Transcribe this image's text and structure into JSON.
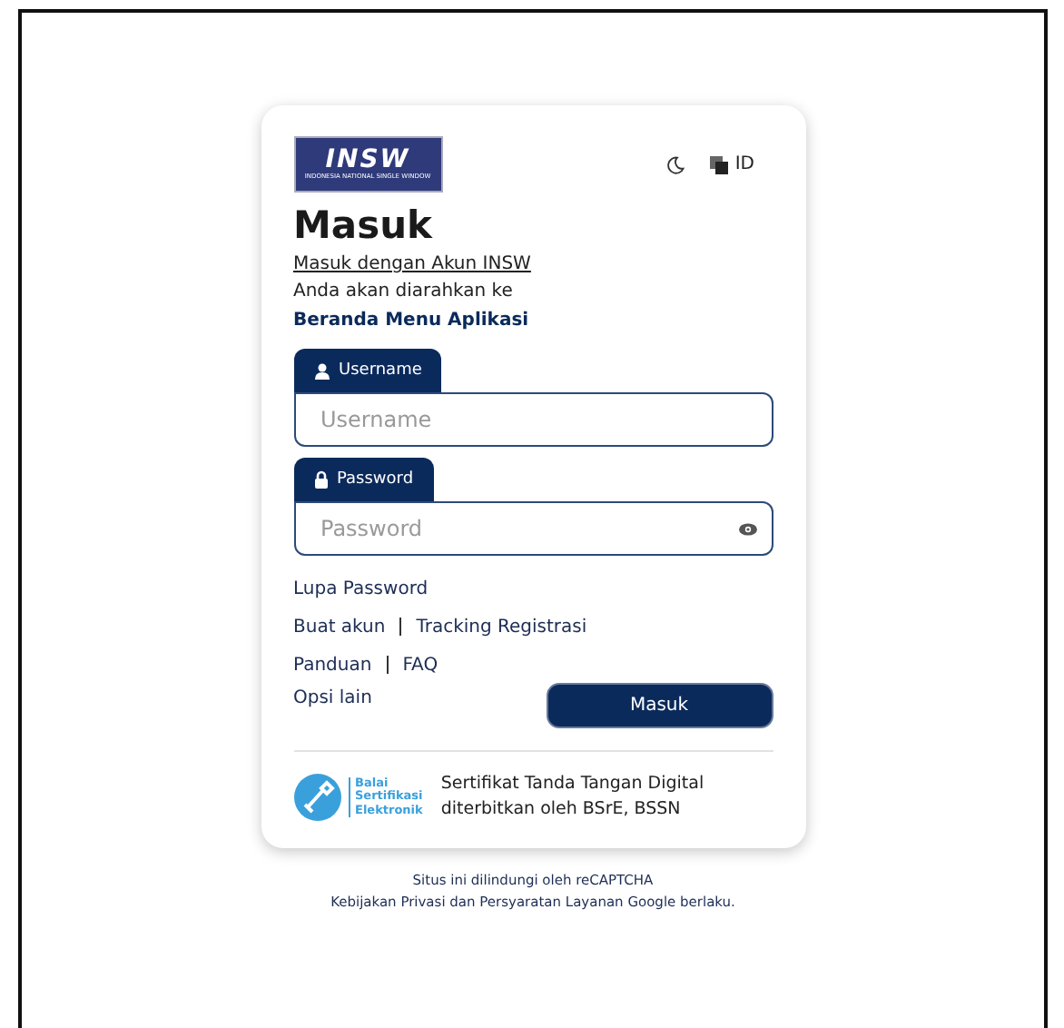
{
  "header": {
    "logo": {
      "mark": "INSW",
      "tagline": "INDONESIA NATIONAL SINGLE WINDOW"
    },
    "language": "ID"
  },
  "title": "Masuk",
  "subtitle_link": "Masuk dengan Akun INSW",
  "redirect_note": "Anda akan diarahkan ke",
  "redirect_target": "Beranda Menu Aplikasi",
  "fields": [
    {
      "kind": "user",
      "tab": "Username",
      "placeholder": "Username"
    },
    {
      "kind": "lock",
      "tab": "Password",
      "placeholder": "Password",
      "reveal": true
    }
  ],
  "link_rows": [
    [
      "Lupa Password"
    ],
    [
      "Buat akun",
      "Tracking Registrasi"
    ],
    [
      "Panduan",
      "FAQ"
    ]
  ],
  "other_options": "Opsi lain",
  "submit": "Masuk",
  "certificate": {
    "logo_lines": [
      "Balai",
      "Sertifikasi",
      "Elektronik"
    ],
    "text": "Sertifikat Tanda Tangan Digital diterbitkan oleh BSrE, BSSN"
  },
  "footer": [
    "Situs ini dilindungi oleh reCAPTCHA",
    "Kebijakan Privasi dan Persyaratan Layanan Google berlaku."
  ]
}
